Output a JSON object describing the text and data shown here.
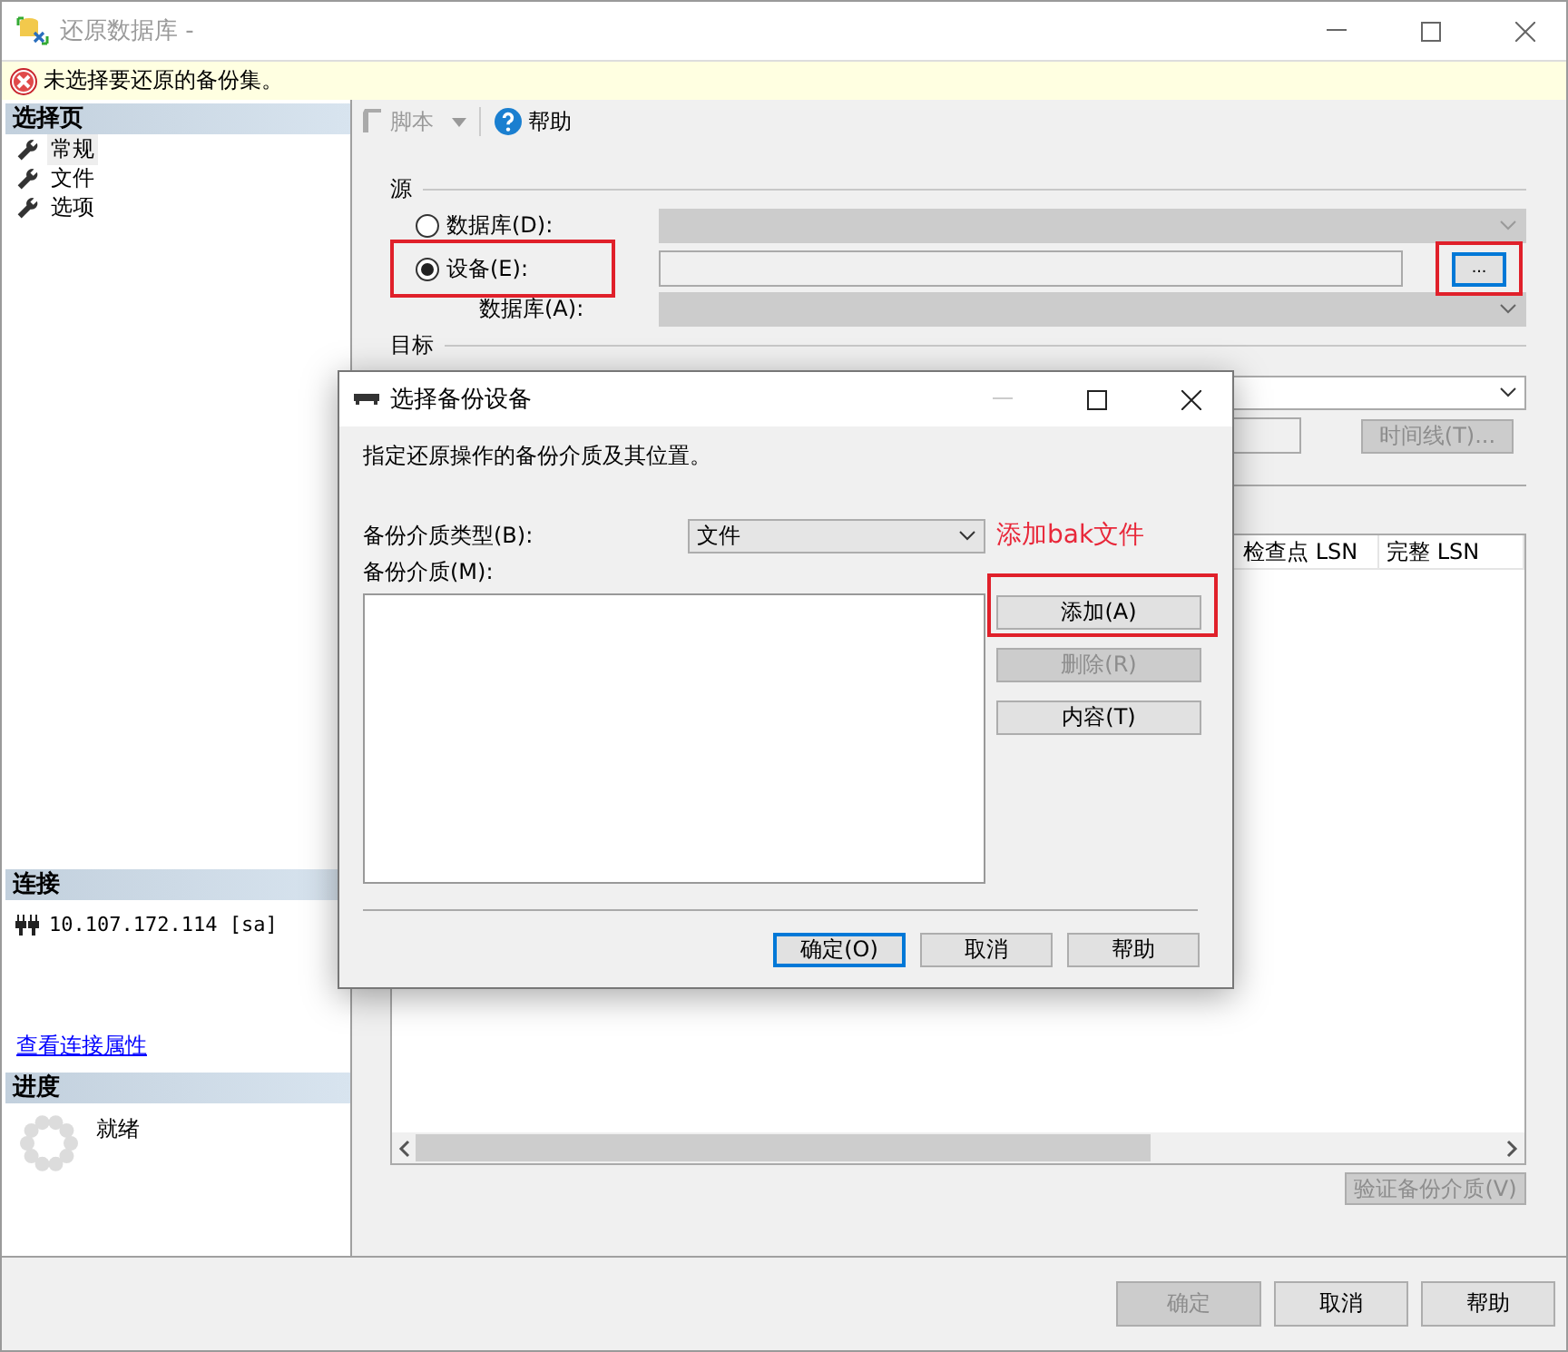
{
  "window": {
    "title": "还原数据库 -"
  },
  "error_bar": {
    "message": "未选择要还原的备份集。"
  },
  "sidebar": {
    "pages_header": "选择页",
    "pages": [
      {
        "label": "常规",
        "selected": true
      },
      {
        "label": "文件",
        "selected": false
      },
      {
        "label": "选项",
        "selected": false
      }
    ],
    "connection_header": "连接",
    "connection": "10.107.172.114 [sa]",
    "connection_link": "查看连接属性",
    "progress_header": "进度",
    "progress_status": "就绪"
  },
  "toolbar": {
    "script": {
      "label": "脚本",
      "disabled": true
    },
    "help": "帮助"
  },
  "source": {
    "title": "源",
    "options": [
      {
        "label": "数据库(D):",
        "selected": false,
        "highlighted": false
      },
      {
        "label": "设备(E):",
        "selected": true,
        "highlighted": true
      }
    ],
    "database_label": "数据库(A):",
    "browse_button": {
      "label": "...",
      "highlighted": true
    }
  },
  "destination": {
    "title": "目标",
    "timeline_button": {
      "label": "时间线(T)...",
      "disabled": true
    }
  },
  "backup_sets": {
    "columns": [
      "检查点 LSN",
      "完整 LSN"
    ]
  },
  "verify_button": {
    "label": "验证备份介质(V)",
    "disabled": true
  },
  "footer_buttons": [
    {
      "label": "确定",
      "disabled": true
    },
    {
      "label": "取消",
      "disabled": false
    },
    {
      "label": "帮助",
      "disabled": false
    }
  ],
  "dialog": {
    "title": "选择备份设备",
    "description": "指定还原操作的备份介质及其位置。",
    "media_type_label": "备份介质类型(B):",
    "media_type": "文件",
    "annotation": "添加bak文件",
    "media_label": "备份介质(M):",
    "side_buttons": [
      {
        "label": "添加(A)",
        "disabled": false,
        "highlighted": true
      },
      {
        "label": "删除(R)",
        "disabled": true,
        "highlighted": false
      },
      {
        "label": "内容(T)",
        "disabled": false,
        "highlighted": false
      }
    ],
    "buttons": [
      {
        "label": "确定(O)",
        "default": true
      },
      {
        "label": "取消",
        "default": false
      },
      {
        "label": "帮助",
        "default": false
      }
    ]
  }
}
